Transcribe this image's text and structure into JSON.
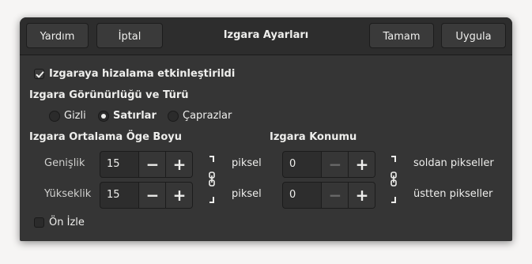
{
  "header": {
    "title": "Izgara Ayarları",
    "help_label": "Yardım",
    "cancel_label": "İptal",
    "ok_label": "Tamam",
    "apply_label": "Uygula"
  },
  "snap": {
    "label": "Izgaraya hizalama etkinleştirildi",
    "checked": true
  },
  "visibility": {
    "heading": "Izgara Görünürlüğü ve Türü",
    "options": [
      "Gizli",
      "Satırlar",
      "Çaprazlar"
    ],
    "selected": "Satırlar"
  },
  "spacing": {
    "heading": "Izgara Ortalama Öge Boyu",
    "width_label": "Genişlik",
    "width_value": "15",
    "height_label": "Yükseklik",
    "height_value": "15",
    "unit_width": "piksel",
    "unit_height": "piksel"
  },
  "offset": {
    "heading": "Izgara Konumu",
    "left_value": "0",
    "top_value": "0",
    "left_unit": "soldan pikseller",
    "top_unit": "üstten pikseller"
  },
  "preview": {
    "label": "Ön İzle",
    "checked": false
  },
  "colors": {
    "dialog_bg": "#353535",
    "header_bg": "#2d2d2d",
    "text": "#eeeeec"
  }
}
